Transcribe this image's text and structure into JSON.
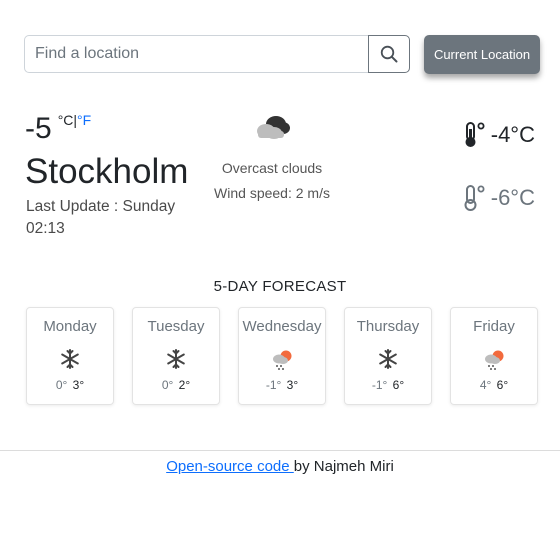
{
  "search": {
    "placeholder": "Find a location",
    "button_icon": "search-icon",
    "current_location_label": "Current Location"
  },
  "current": {
    "temperature": "-5",
    "unit_c": "°C",
    "unit_separator": "|",
    "unit_f": "°F",
    "city": "Stockholm",
    "last_update": "Last Update : Sunday 02:13",
    "condition_icon": "overcast-cloud-icon",
    "condition": "Overcast clouds",
    "wind": "Wind speed: 2 m/s",
    "high": "-4°C",
    "low": "-6°C"
  },
  "forecast": {
    "title": "5-DAY FORECAST",
    "days": [
      {
        "name": "Monday",
        "icon": "snowflake-icon",
        "min": "0°",
        "max": "3°"
      },
      {
        "name": "Tuesday",
        "icon": "snowflake-icon",
        "min": "0°",
        "max": "2°"
      },
      {
        "name": "Wednesday",
        "icon": "snow-sun-cloud-icon",
        "min": "-1°",
        "max": "3°"
      },
      {
        "name": "Thursday",
        "icon": "snowflake-icon",
        "min": "-1°",
        "max": "6°"
      },
      {
        "name": "Friday",
        "icon": "snow-sun-cloud-icon",
        "min": "4°",
        "max": "6°"
      }
    ]
  },
  "footer": {
    "link_text": "Open-source code ",
    "suffix": "by Najmeh Miri"
  },
  "colors": {
    "link": "#0d6efd",
    "button_gray": "#6c757d",
    "sun_orange": "#f26a3d"
  }
}
